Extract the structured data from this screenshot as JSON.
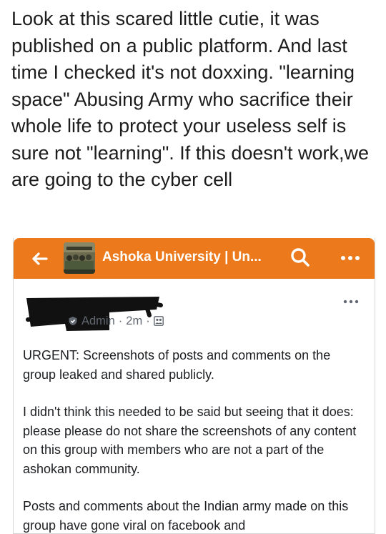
{
  "caption": "Look at this scared little cutie, it was published on a public platform. And last time I checked it's not doxxing. \"learning space\" Abusing Army who sacrifice their whole life to protect your useless self is sure not \"learning\". If this doesn't work,we are going to the cyber cell",
  "app_bar": {
    "group_name": "Ashoka University | Un...",
    "back_icon": "arrow-left-icon",
    "search_icon": "search-icon",
    "more_icon": "more-horizontal-icon",
    "bar_color": "#ec7a1c"
  },
  "post": {
    "author_role": "Admin",
    "separator": "·",
    "time": "2m",
    "privacy_icon": "group-members-icon",
    "paragraphs": [
      "URGENT: Screenshots of posts and comments on the group leaked and shared publicly.",
      "I didn't think this needed to be said but seeing that it does: please please do not share the screenshots of any content on this group with members who are not a part of the ashokan community.",
      "Posts and comments about the Indian army made on this group have gone viral on facebook and"
    ]
  }
}
